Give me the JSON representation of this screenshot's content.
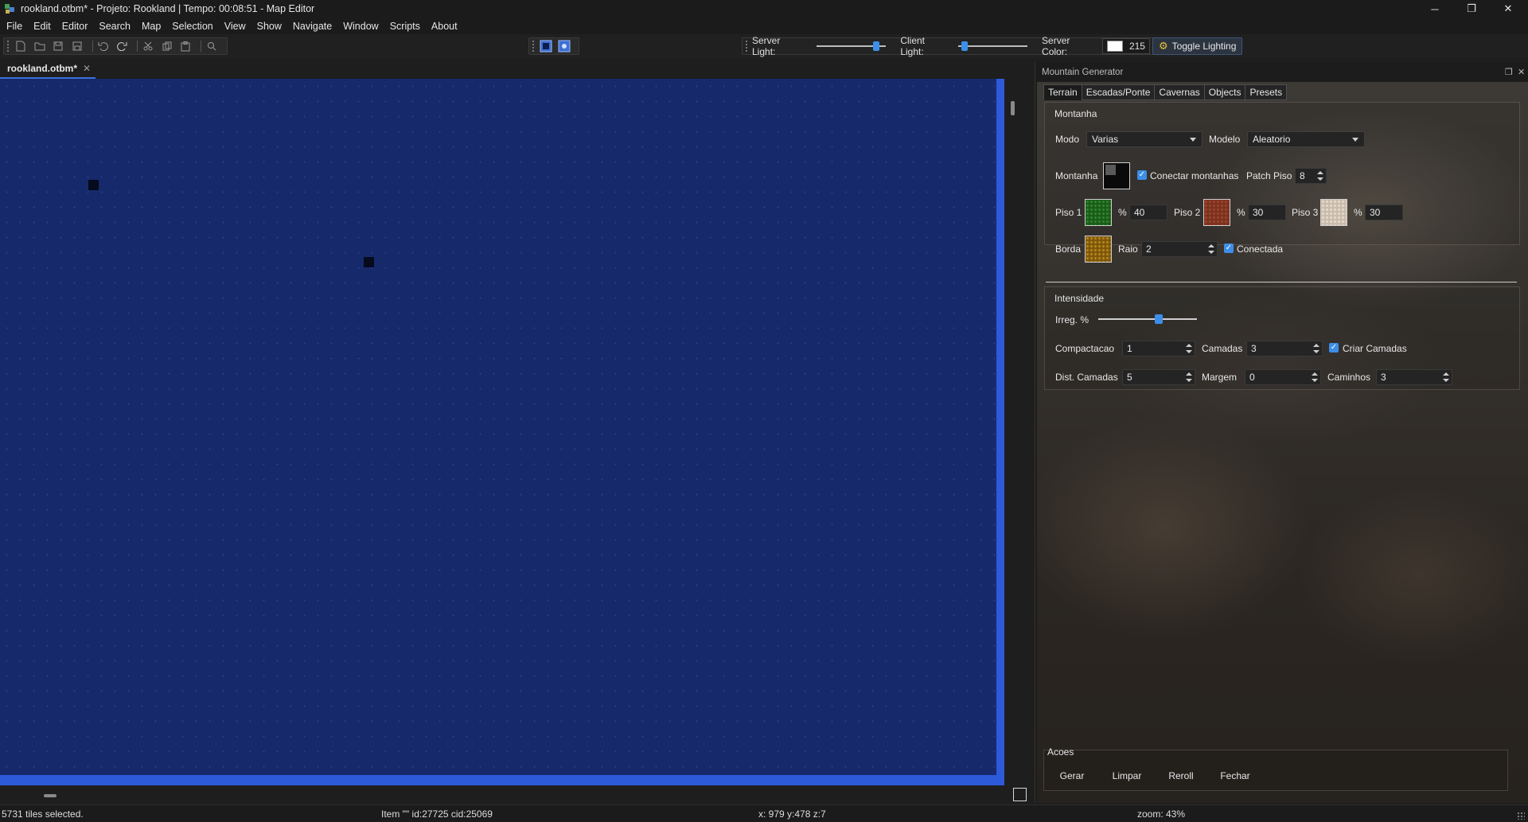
{
  "window": {
    "title": "rookland.otbm* - Projeto: Rookland | Tempo: 00:08:51 - Map Editor",
    "minimize": "─",
    "restore": "❐",
    "close": "✕"
  },
  "menu": [
    "File",
    "Edit",
    "Editor",
    "Search",
    "Map",
    "Selection",
    "View",
    "Show",
    "Navigate",
    "Window",
    "Scripts",
    "About"
  ],
  "toolbar": {
    "server_light_label": "Server Light:",
    "server_light_level": 0.9,
    "client_light_label": "Client Light:",
    "client_light_level": 0.05,
    "server_color_label": "Server Color:",
    "server_color_value": "215",
    "server_color_swatch": "#ffffff",
    "toggle_lighting_label": "Toggle Lighting",
    "icons": [
      "new-file-icon",
      "open-icon",
      "save-icon",
      "save-all-icon",
      "undo-icon",
      "redo-icon",
      "cut-icon",
      "copy-icon",
      "paste-icon",
      "search-icon"
    ],
    "view_icons": [
      "single-floor-view-icon",
      "all-floors-view-icon"
    ]
  },
  "document_tab": {
    "label": "rookland.otbm*",
    "close": "✕"
  },
  "map": {
    "background_color": "#162a6b"
  },
  "panel": {
    "title": "Mountain Generator",
    "tabs": [
      "Terrain",
      "Escadas/Ponte",
      "Cavernas",
      "Objects",
      "Presets"
    ],
    "active_tab": "Terrain",
    "montanha_group": {
      "title": "Montanha",
      "modo_label": "Modo",
      "modo_value": "Varias",
      "modelo_label": "Modelo",
      "modelo_value": "Aleatorio",
      "montanha_label": "Montanha",
      "conectar_label": "Conectar montanhas",
      "conectar_checked": true,
      "patch_piso_label": "Patch Piso",
      "patch_piso_value": "8",
      "piso1_label": "Piso 1",
      "piso1_pct_label": "%",
      "piso1_pct": "40",
      "piso2_label": "Piso 2",
      "piso2_pct_label": "%",
      "piso2_pct": "30",
      "piso3_label": "Piso 3",
      "piso3_pct_label": "%",
      "piso3_pct": "30",
      "borda_label": "Borda",
      "raio_label": "Raio",
      "raio_value": "2",
      "conectada_label": "Conectada",
      "conectada_checked": true
    },
    "intensidade_group": {
      "title": "Intensidade",
      "irreg_label": "Irreg. %",
      "irreg_level": 0.62,
      "compactacao_label": "Compactacao",
      "compactacao_value": "1",
      "camadas_label": "Camadas",
      "camadas_value": "3",
      "criar_camadas_label": "Criar Camadas",
      "criar_camadas_checked": true,
      "dist_camadas_label": "Dist. Camadas",
      "dist_camadas_value": "5",
      "margem_label": "Margem",
      "margem_value": "0",
      "caminhos_label": "Caminhos",
      "caminhos_value": "3"
    },
    "acoes_group": {
      "title": "Acoes",
      "buttons": [
        "Gerar",
        "Limpar",
        "Reroll",
        "Fechar"
      ]
    }
  },
  "status": {
    "selection": "5731 tiles selected.",
    "item": "Item \"\" id:27725 cid:25069",
    "position": "x: 979 y:478 z:7",
    "zoom": "zoom: 43%"
  }
}
